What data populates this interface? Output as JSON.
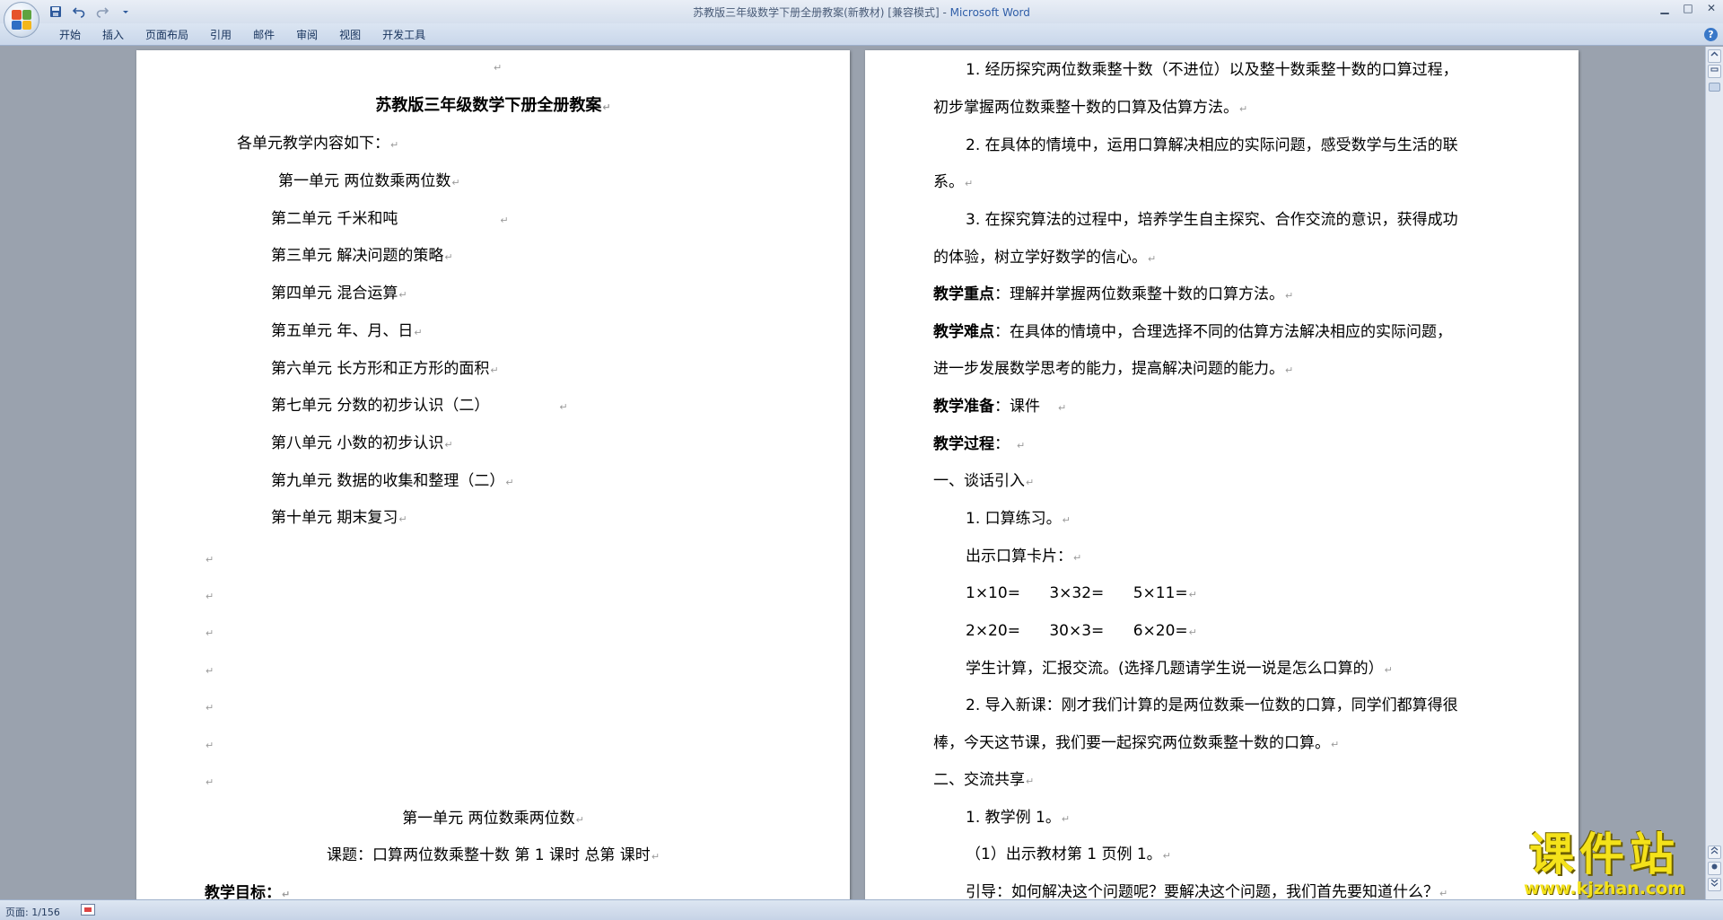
{
  "window": {
    "title_doc": "苏教版三年级数学下册全册教案(新教材) [兼容模式] -",
    "title_app": "Microsoft Word",
    "minimize": "▁",
    "maximize": "□",
    "close": "✕"
  },
  "ribbon": {
    "tabs": [
      "开始",
      "插入",
      "页面布局",
      "引用",
      "邮件",
      "审阅",
      "视图",
      "开发工具"
    ],
    "help": "?"
  },
  "qat": {
    "save_icon": "floppy-disk-icon",
    "undo_icon": "undo-icon",
    "redo_icon": "redo-icon",
    "more_icon": "dropdown-arrow-icon"
  },
  "status": {
    "page_info": "页面: 1/156"
  },
  "paragraph_mark": "↵",
  "left_page": {
    "title": "苏教版三年级数学下册全册教案",
    "intro": "各单元教学内容如下：",
    "units": [
      "第一单元   两位数乘两位数",
      "第二单元   千米和吨",
      "第三单元   解决问题的策略",
      "第四单元   混合运算",
      "第五单元   年、月、日",
      "第六单元   长方形和正方形的面积",
      "第七单元   分数的初步认识（二）",
      "第八单元   小数的初步认识",
      "第九单元   数据的收集和整理（二）",
      "第十单元   期末复习"
    ],
    "unit1_heading": "第一单元    两位数乘两位数",
    "lesson_title": "课题：口算两位数乘整十数    第  1  课时    总第    课时",
    "goals_label": "教学目标："
  },
  "right_page": {
    "goal1_a": "1. 经历探究两位数乘整十数（不进位）以及整十数乘整十数的口算过程，",
    "goal1_b": "初步掌握两位数乘整十数的口算及估算方法。",
    "goal2_a": "2. 在具体的情境中，运用口算解决相应的实际问题，感受数学与生活的联",
    "goal2_b": "系。",
    "goal3_a": "3. 在探究算法的过程中，培养学生自主探究、合作交流的意识，获得成功",
    "goal3_b": "的体验，树立学好数学的信心。",
    "key_label": "教学重点",
    "key_text": "：理解并掌握两位数乘整十数的口算方法。",
    "diff_label": "教学难点",
    "diff_text_a": "：在具体的情境中，合理选择不同的估算方法解决相应的实际问题，",
    "diff_text_b": "进一步发展数学思考的能力，提高解决问题的能力。",
    "prep_label": "教学准备",
    "prep_text": "：课件",
    "process_label": "教学过程",
    "process_text": "：",
    "sec1": "一、谈话引入",
    "oral": "1. 口算练习。",
    "cards": "出示口算卡片：",
    "calc_row1": "1×10=      3×32=      5×11=",
    "calc_row2": "2×20=      30×3=      6×20=",
    "report": "学生计算，汇报交流。(选择几题请学生说一说是怎么口算的）",
    "intro_a": "2. 导入新课：刚才我们计算的是两位数乘一位数的口算，同学们都算得很",
    "intro_b": "棒，今天这节课，我们要一起探究两位数乘整十数的口算。",
    "sec2": "二、交流共享",
    "ex1": "1. 教学例 1。",
    "ex1_1": "（1）出示教材第 1 页例 1。",
    "guide": "引导：如何解决这个问题呢？要解决这个问题，我们首先要知道什么？"
  },
  "watermark": {
    "title": "课件站",
    "url": "www.kjzhan.com"
  }
}
